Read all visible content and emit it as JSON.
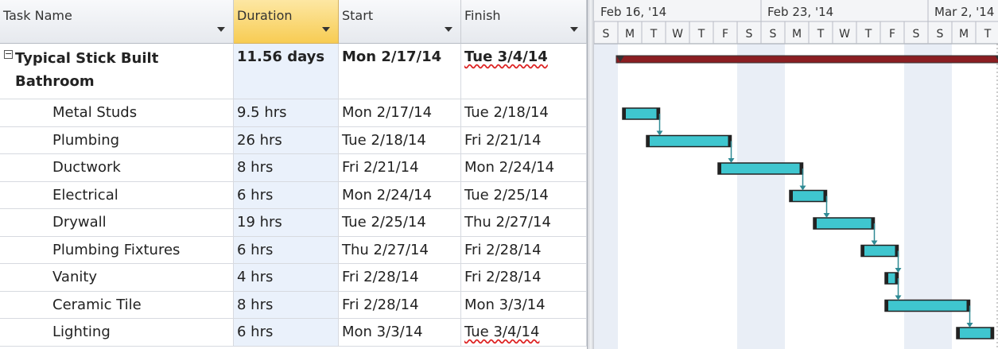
{
  "columns": {
    "task_name": "Task Name",
    "duration": "Duration",
    "start": "Start",
    "finish": "Finish"
  },
  "summary": {
    "toggle": "−",
    "name": "Typical Stick Built Bathroom",
    "duration": "11.56 days",
    "start": "Mon 2/17/14",
    "finish": "Tue 3/4/14"
  },
  "tasks": [
    {
      "name": "Metal Studs",
      "duration": "9.5 hrs",
      "start": "Mon 2/17/14",
      "finish": "Tue 2/18/14"
    },
    {
      "name": "Plumbing",
      "duration": "26 hrs",
      "start": "Tue 2/18/14",
      "finish": "Fri 2/21/14"
    },
    {
      "name": "Ductwork",
      "duration": "8 hrs",
      "start": "Fri 2/21/14",
      "finish": "Mon 2/24/14"
    },
    {
      "name": "Electrical",
      "duration": "6 hrs",
      "start": "Mon 2/24/14",
      "finish": "Tue 2/25/14"
    },
    {
      "name": "Drywall",
      "duration": "19 hrs",
      "start": "Tue 2/25/14",
      "finish": "Thu 2/27/14"
    },
    {
      "name": "Plumbing Fixtures",
      "duration": "6 hrs",
      "start": "Thu 2/27/14",
      "finish": "Fri 2/28/14"
    },
    {
      "name": "Vanity",
      "duration": "4 hrs",
      "start": "Fri 2/28/14",
      "finish": "Fri 2/28/14"
    },
    {
      "name": "Ceramic Tile",
      "duration": "8 hrs",
      "start": "Fri 2/28/14",
      "finish": "Mon 3/3/14"
    },
    {
      "name": "Lighting",
      "duration": "6 hrs",
      "start": "Mon 3/3/14",
      "finish": "Tue 3/4/14"
    }
  ],
  "timeline": {
    "weeks": [
      "Feb 16, '14",
      "Feb 23, '14",
      "Mar 2, '14"
    ],
    "days": [
      "S",
      "M",
      "T",
      "W",
      "T",
      "F",
      "S",
      "S",
      "M",
      "T",
      "W",
      "T",
      "F",
      "S",
      "S",
      "M",
      "T"
    ]
  },
  "colors": {
    "task_bar": "#3fc6cf",
    "summary_bar": "#8b1e22",
    "link": "#2f8a94",
    "weekend": "#e9eef6",
    "selected_header": "#f7cc53"
  }
}
